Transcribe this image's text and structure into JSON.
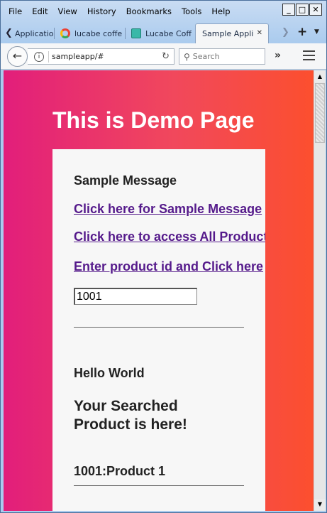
{
  "menu": [
    "File",
    "Edit",
    "View",
    "History",
    "Bookmarks",
    "Tools",
    "Help"
  ],
  "window_controls": {
    "minimize": "_",
    "restore": "□",
    "close": "✕"
  },
  "tabs": [
    {
      "label": "Applicatio",
      "icon": "page-icon"
    },
    {
      "label": "lucabe coffe",
      "icon": "google-icon"
    },
    {
      "label": "Lucabe Coff",
      "icon": "teal-page-icon"
    },
    {
      "label": "Sample Applic",
      "icon": "page-icon",
      "active": true
    }
  ],
  "tab_close": "✕",
  "new_tab": "+",
  "url": "sampleapp/#",
  "search_placeholder": "Search",
  "page": {
    "title": "This is Demo Page",
    "message_heading": "Sample Message",
    "links": [
      "Click here for Sample Message",
      "Click here to access All Products",
      "Enter product id and Click here"
    ],
    "product_id_value": "1001",
    "hello": "Hello World",
    "searched_heading": "Your Searched Product is here!",
    "product_result": "1001:Product 1"
  },
  "colors": {
    "gradient_start": "#e21e7b",
    "gradient_end": "#fc4f2e",
    "link": "#551a8b",
    "card": "#f7f7f7"
  }
}
